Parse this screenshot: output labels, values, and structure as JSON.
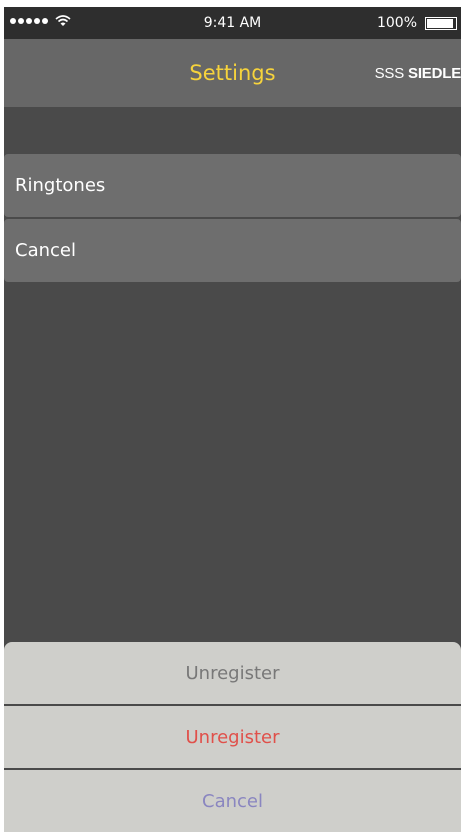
{
  "status_bar": {
    "signal_dots": 5,
    "time": "9:41 AM",
    "battery_text": "100%",
    "battery_level": 1.0
  },
  "nav": {
    "title": "Settings",
    "logo_mark": "SSS",
    "logo_brand": "SIEDLE"
  },
  "list": {
    "items": [
      {
        "label": "Ringtones"
      },
      {
        "label": "Cancel"
      }
    ]
  },
  "action_sheet": {
    "title": "Unregister",
    "destructive_label": "Unregister",
    "cancel_label": "Cancel"
  },
  "colors": {
    "title_accent": "#f6d33c",
    "destructive": "#e0504a",
    "cancel": "#8a86c0",
    "sheet_title": "#787878"
  }
}
